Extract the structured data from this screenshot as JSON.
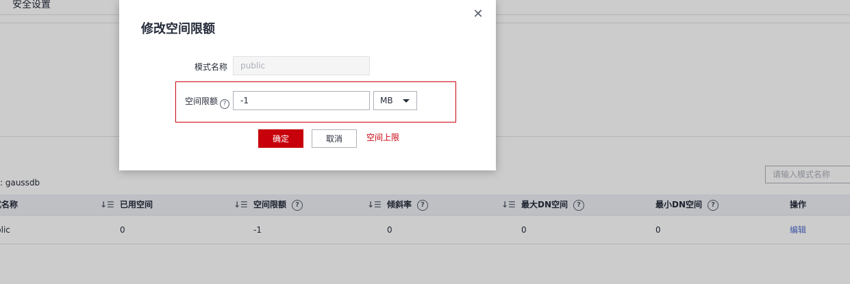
{
  "background": {
    "section_title": "安全设置",
    "database_label": "库: gaussdb",
    "search_placeholder": "请输入模式名称",
    "table": {
      "headers": [
        "式名称",
        "已用空间",
        "空间限额",
        "倾斜率",
        "最大DN空间",
        "最小DN空间",
        "操作"
      ],
      "rows": [
        {
          "schema": "blic",
          "used": "0",
          "quota": "-1",
          "skew": "0",
          "max_dn": "0",
          "min_dn": "0",
          "action": "编辑"
        }
      ]
    }
  },
  "dialog": {
    "title": "修改空间限额",
    "close_icon": "close-icon",
    "schema_label": "模式名称",
    "schema_value": "public",
    "quota_label": "空间限额",
    "help_icon": "question-circle-icon",
    "quota_value": "-1",
    "unit_value": "MB",
    "ok_label": "确定",
    "cancel_label": "取消",
    "annotation": "空间上限",
    "highlight_color": "#c7000b"
  }
}
